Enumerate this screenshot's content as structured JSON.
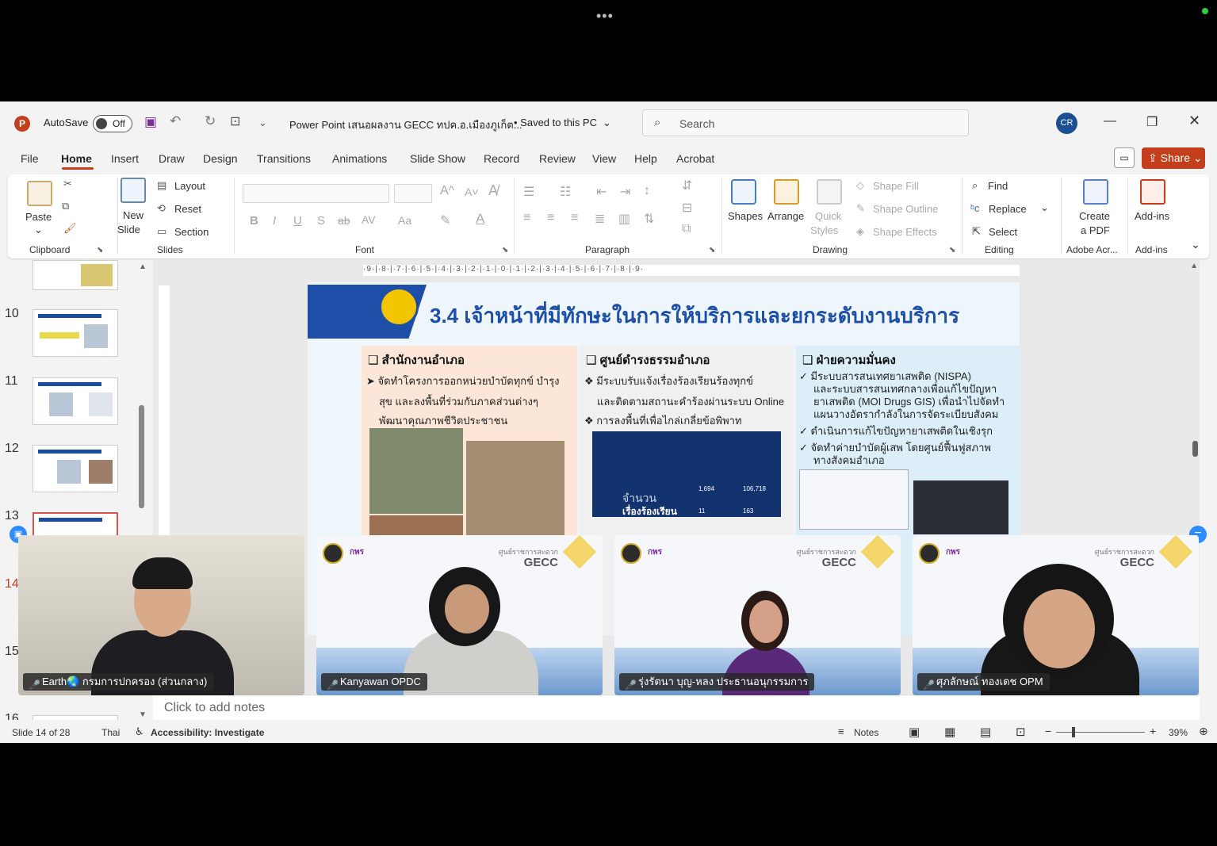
{
  "title_bar": {
    "autosave_label": "AutoSave",
    "autosave_state": "Off",
    "doc_title": "Power Point เสนอผลงาน GECC ทปค.อ.เมืองภูเก็ต...",
    "saved_status": "• Saved to this PC",
    "search_placeholder": "Search",
    "user_initials": "CR"
  },
  "menu": {
    "tabs": [
      "File",
      "Home",
      "Insert",
      "Draw",
      "Design",
      "Transitions",
      "Animations",
      "Slide Show",
      "Record",
      "Review",
      "View",
      "Help",
      "Acrobat"
    ],
    "share_label": "Share"
  },
  "ribbon": {
    "clipboard": {
      "paste": "Paste",
      "label": "Clipboard"
    },
    "slides": {
      "new_slide_1": "New",
      "new_slide_2": "Slide",
      "layout": "Layout",
      "reset": "Reset",
      "section": "Section",
      "label": "Slides"
    },
    "font": {
      "label": "Font",
      "bold": "B",
      "italic": "I",
      "underline": "U",
      "shadow": "S",
      "strike": "ab",
      "spacing": "AV",
      "case": "Aa",
      "grow": "A^",
      "shrink": "A˅"
    },
    "paragraph": {
      "label": "Paragraph"
    },
    "drawing": {
      "shapes": "Shapes",
      "arrange": "Arrange",
      "quick_1": "Quick",
      "quick_2": "Styles",
      "shape_fill": "Shape Fill",
      "shape_outline": "Shape Outline",
      "shape_effects": "Shape Effects",
      "label": "Drawing"
    },
    "editing": {
      "find": "Find",
      "replace": "Replace",
      "select": "Select",
      "label": "Editing"
    },
    "adobe": {
      "create_1": "Create",
      "create_2": "a PDF",
      "label": "Adobe Acr..."
    },
    "addins": {
      "addins": "Add-ins",
      "label": "Add-ins"
    }
  },
  "thumbnails": {
    "numbers": [
      "10",
      "11",
      "12",
      "13",
      "14",
      "15",
      "16"
    ]
  },
  "slide": {
    "title": "3.4 เจ้าหน้าที่มีทักษะในการให้บริการและยกระดับงานบริการ",
    "col1": {
      "head": "❑ สำนักงานอำเภอ",
      "lines": [
        "➤  จัดทำโครงการออกหน่วยบำบัดทุกข์ บำรุง",
        "สุข และลงพื้นที่ร่วมกับภาคส่วนต่างๆ",
        "พัฒนาคุณภาพชีวิตประชาชน"
      ]
    },
    "col2": {
      "head": "❑ ศูนย์ดำรงธรรมอำเภอ",
      "lines": [
        "❖  มีระบบรับแจ้งเรื่องร้องเรียนร้องทุกข์",
        "และติดตามสถานะคำร้องผ่านระบบ Online",
        "❖  การลงพื้นที่เพื่อไกล่เกลี่ยข้อพิพาท"
      ],
      "screen_text_1": "จำนวน",
      "screen_text_2": "เรื่องร้องเรียน",
      "stat_1": "1,694",
      "stat_2": "106,718",
      "stat_3": "11",
      "stat_4": "163"
    },
    "col3": {
      "head": "❑ ฝ่ายความมั่นคง",
      "lines": [
        "✓  มีระบบสารสนเทศยาเสพติด (NISPA)",
        "และระบบสารสนเทศกลางเพื่อแก้ไขปัญหา",
        "ยาเสพติด (MOI Drugs GIS) เพื่อนำไปจัดทำ",
        "แผนวางอัตรากำลังในการจัดระเบียบสังคม",
        "✓  ดำเนินการแก้ไขปัญหายาเสพติดในเชิงรุก",
        "✓  จัดทำค่ายบำบัดผู้เสพ โดยศูนย์ฟื้นฟูสภาพ",
        "ทางสังคมอำเภอ"
      ]
    }
  },
  "notes_placeholder": "Click to add notes",
  "status_bar": {
    "slide_info": "Slide 14 of 28",
    "language": "Thai",
    "accessibility": "Accessibility: Investigate",
    "notes": "Notes",
    "zoom": "39%"
  },
  "video_tiles": [
    {
      "name": "Earth🌏 กรมการปกครอง (ส่วนกลาง)"
    },
    {
      "name": "Kanyawan OPDC"
    },
    {
      "name": "รุ่งรัตนา บุญ-หลง ประธานอนุกรรมการ"
    },
    {
      "name": "ศุภลักษณ์ ทองเดช OPM"
    }
  ],
  "tile_brand": {
    "gecc": "GECC",
    "gecc_sub": "ศูนย์ราชการสะดวก",
    "opdc": "กพร"
  },
  "ruler_text": "·9·|·8·|·7·|·6·|·5·|·4·|·3·|·2·|·1·|·0·|·1·|·2·|·3·|·4·|·5·|·6·|·7·|·8·|·9·",
  "colors": {
    "accent": "#c43e1c",
    "slide_blue": "#1d4fa8",
    "zoom_blue": "#2d8cff"
  }
}
